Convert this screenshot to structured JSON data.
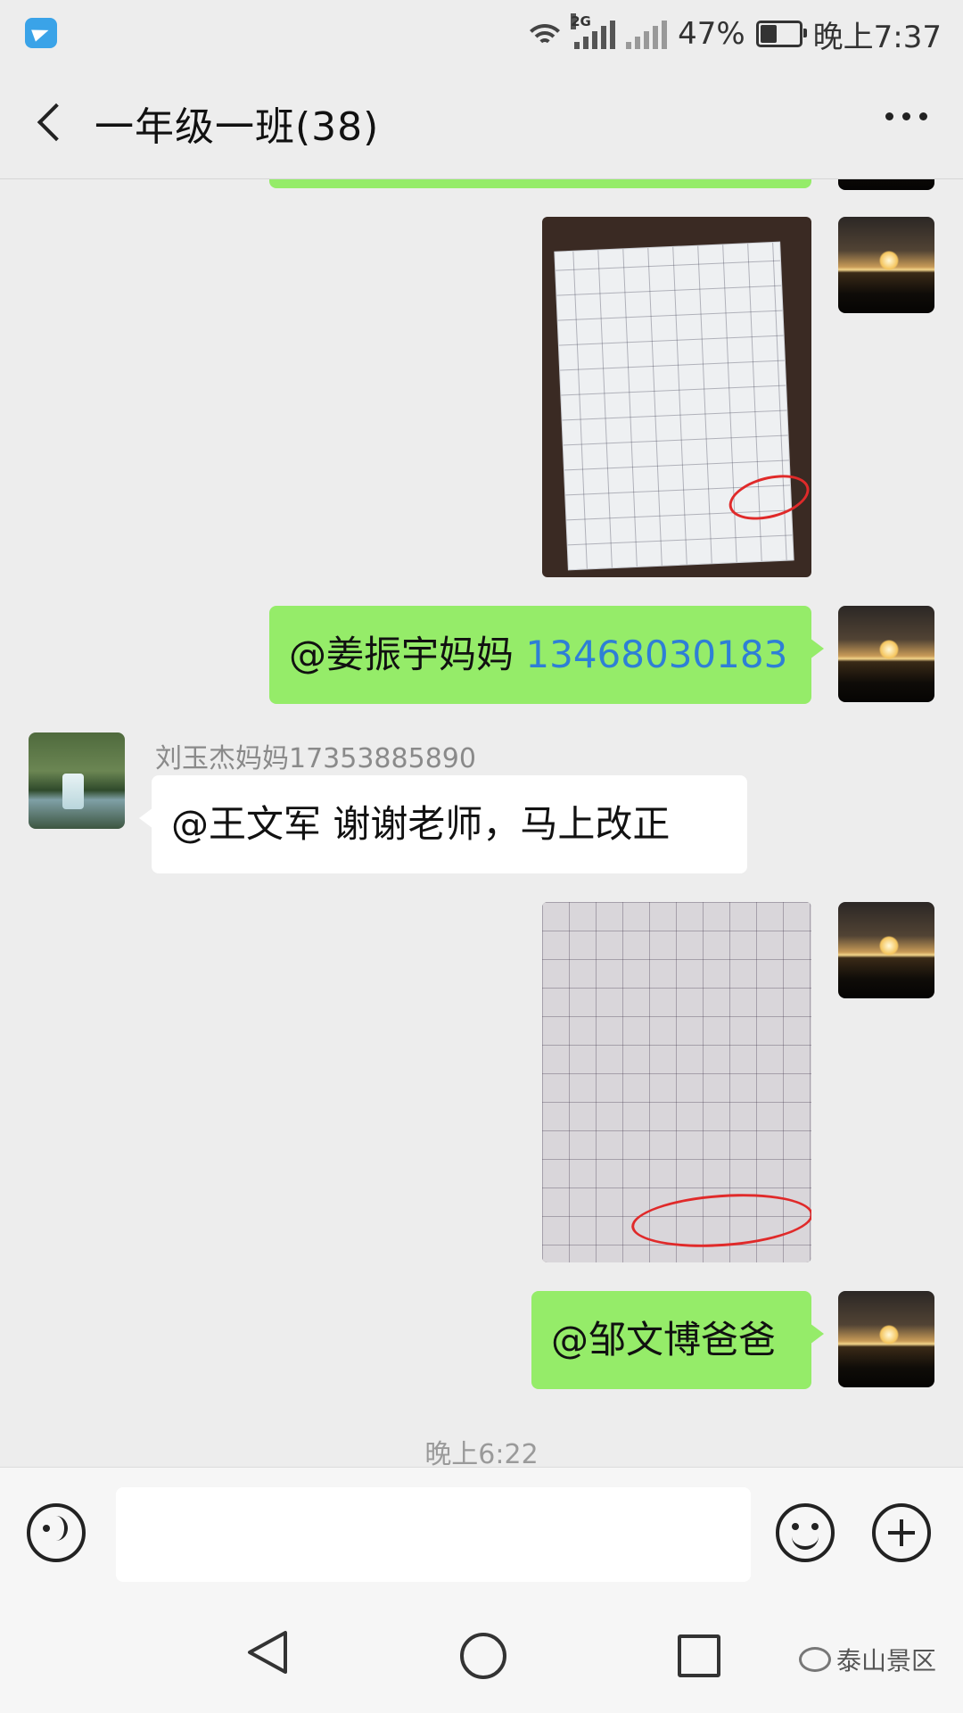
{
  "status_bar": {
    "network": "2G",
    "battery": "47%",
    "battery_level": 0.47,
    "time": "晚上7:37"
  },
  "header": {
    "title": "一年级一班(38)"
  },
  "messages": [
    {
      "type": "image",
      "direction": "outgoing",
      "content": "handwriting-worksheet-photo"
    },
    {
      "type": "text",
      "direction": "outgoing",
      "mention": "@姜振宇妈妈",
      "phone": "13468030183"
    },
    {
      "type": "text",
      "direction": "incoming",
      "sender": "刘玉杰妈妈17353885890",
      "text": "@王文军  谢谢老师，马上改正"
    },
    {
      "type": "image",
      "direction": "outgoing",
      "content": "handwriting-worksheet-photo"
    },
    {
      "type": "text",
      "direction": "outgoing",
      "text": "@邹文博爸爸"
    }
  ],
  "timestamp": "晚上6:22",
  "watermark": "泰山景区",
  "colors": {
    "bubble_out": "#95ec69",
    "bubble_in": "#ffffff",
    "background": "#ededed",
    "phone_link": "#2e7fd6",
    "annotation_red": "#e02a2a"
  }
}
